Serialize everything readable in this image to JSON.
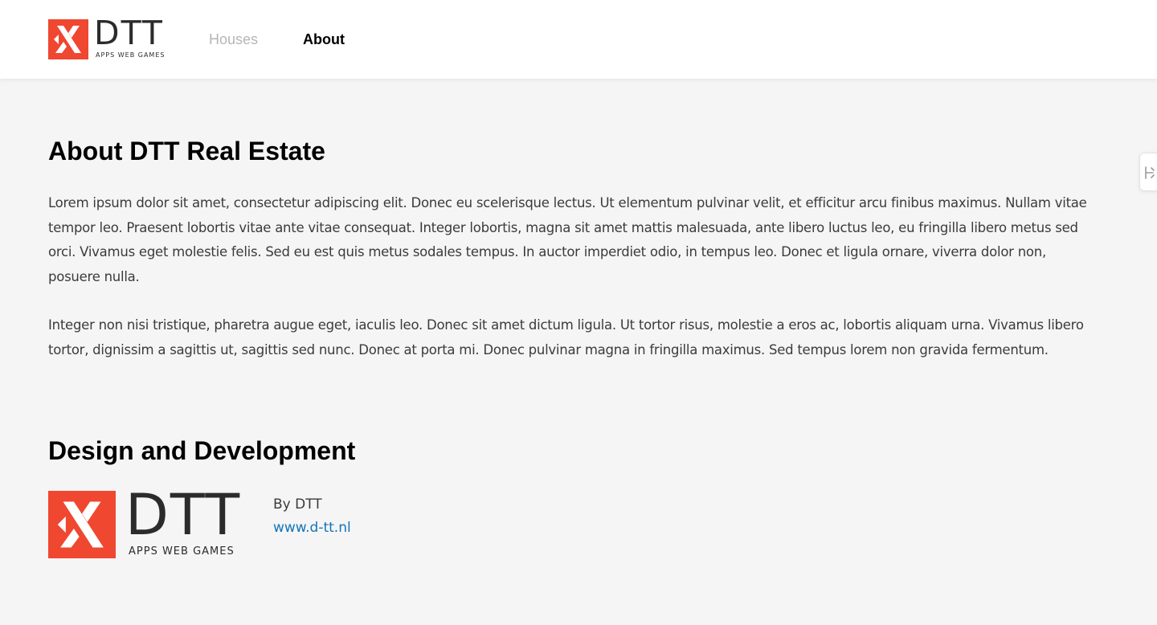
{
  "header": {
    "logo": {
      "wordmark": "DTT",
      "tagline": "APPS WEB GAMES",
      "icon": "dtt-x-logo-icon"
    },
    "nav": [
      {
        "label": "Houses",
        "active": false
      },
      {
        "label": "About",
        "active": true
      }
    ]
  },
  "main": {
    "title": "About DTT Real Estate",
    "paragraphs": [
      "Lorem ipsum dolor sit amet, consectetur adipiscing elit. Donec eu scelerisque lectus. Ut elementum pulvinar velit, et efficitur arcu finibus maximus. Nullam vitae tempor leo. Praesent lobortis vitae ante vitae consequat. Integer lobortis, magna sit amet mattis malesuada, ante libero luctus leo, eu fringilla libero metus sed orci. Vivamus eget molestie felis. Sed eu est quis metus sodales tempus. In auctor imperdiet odio, in tempus leo. Donec et ligula ornare, viverra dolor non, posuere nulla.",
      "Integer non nisi tristique, pharetra augue eget, iaculis leo. Donec sit amet dictum ligula. Ut tortor risus, molestie a eros ac, lobortis aliquam urna. Vivamus libero tortor, dignissim a sagittis ut, sagittis sed nunc. Donec at porta mi. Donec pulvinar magna in fringilla maximus. Sed tempus lorem non gravida fermentum."
    ],
    "design_section": {
      "title": "Design and Development",
      "logo": {
        "wordmark": "DTT",
        "tagline": "APPS WEB GAMES"
      },
      "by_text": "By DTT",
      "link_text": "www.d-tt.nl"
    }
  },
  "side_tab": {
    "icon": "extension-handle-icon"
  },
  "colors": {
    "brand_red": "#f04730",
    "link_blue": "#1274b8",
    "page_background": "#f5f5f5",
    "nav_inactive": "#b5b5b5"
  }
}
